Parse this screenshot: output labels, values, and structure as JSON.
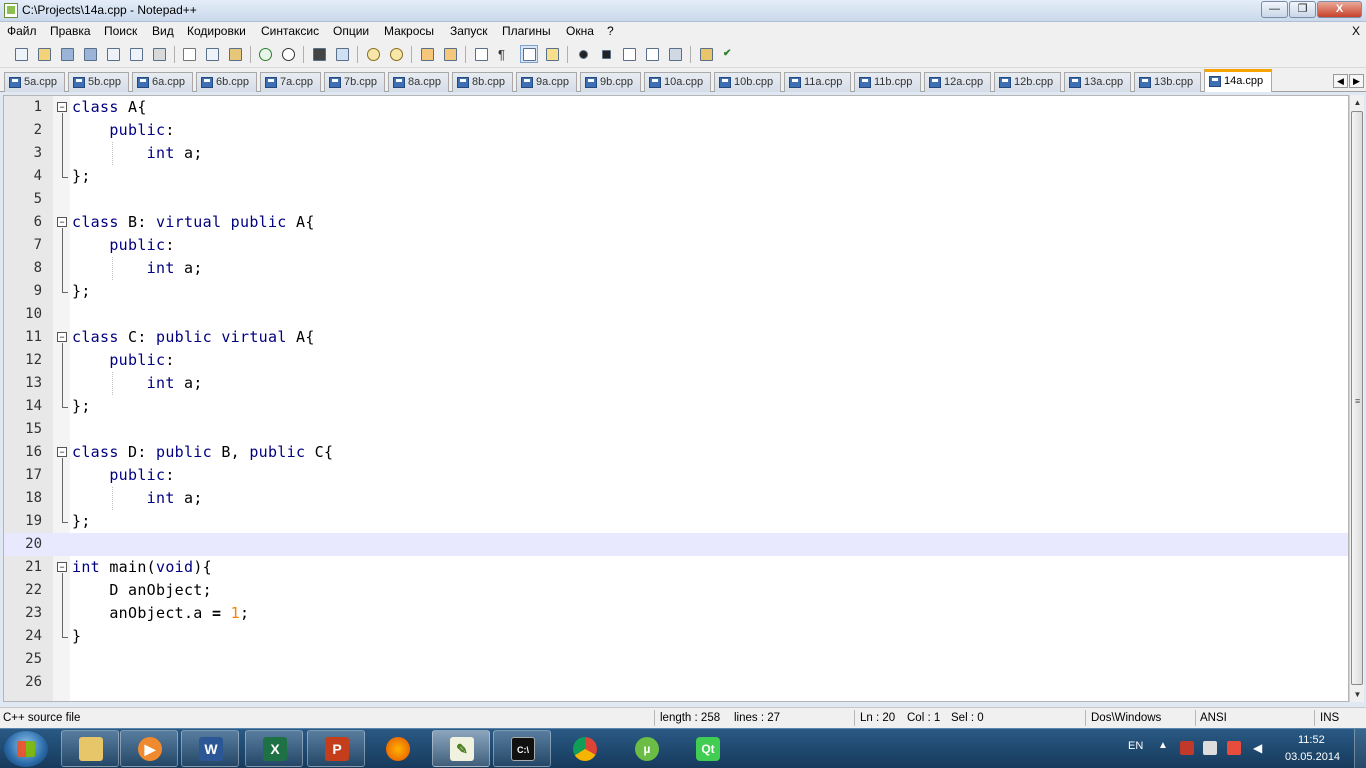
{
  "window": {
    "title": "C:\\Projects\\14a.cpp - Notepad++",
    "min": "—",
    "max": "❐",
    "close": "X"
  },
  "menu": {
    "items": [
      "Файл",
      "Правка",
      "Поиск",
      "Вид",
      "Кодировки",
      "Синтаксис",
      "Опции",
      "Макросы",
      "Запуск",
      "Плагины",
      "Окна",
      "?"
    ],
    "close": "X"
  },
  "tabs": {
    "items": [
      "5a.cpp",
      "5b.cpp",
      "6a.cpp",
      "6b.cpp",
      "7a.cpp",
      "7b.cpp",
      "8a.cpp",
      "8b.cpp",
      "9a.cpp",
      "9b.cpp",
      "10a.cpp",
      "10b.cpp",
      "11a.cpp",
      "11b.cpp",
      "12a.cpp",
      "12b.cpp",
      "13a.cpp",
      "13b.cpp",
      "14a.cpp"
    ],
    "active_index": 18,
    "nav_left": "◀",
    "nav_right": "▶"
  },
  "editor": {
    "current_line": 20,
    "line_numbers": [
      "1",
      "2",
      "3",
      "4",
      "5",
      "6",
      "7",
      "8",
      "9",
      "10",
      "11",
      "12",
      "13",
      "14",
      "15",
      "16",
      "17",
      "18",
      "19",
      "20",
      "21",
      "22",
      "23",
      "24",
      "25",
      "26"
    ],
    "lines": {
      "l1": [
        "class",
        " A{"
      ],
      "l2": [
        "public",
        ":"
      ],
      "l3": [
        "int",
        " a;"
      ],
      "l4": "};",
      "l6": [
        "class",
        " B: ",
        "virtual",
        " ",
        "public",
        " A{"
      ],
      "l7": [
        "public",
        ":"
      ],
      "l8": [
        "int",
        " a;"
      ],
      "l9": "};",
      "l11": [
        "class",
        " C: ",
        "public",
        " ",
        "virtual",
        " A{"
      ],
      "l12": [
        "public",
        ":"
      ],
      "l13": [
        "int",
        " a;"
      ],
      "l14": "};",
      "l16": [
        "class",
        " D: ",
        "public",
        " B, ",
        "public",
        " C{"
      ],
      "l17": [
        "public",
        ":"
      ],
      "l18": [
        "int",
        " a;"
      ],
      "l19": "};",
      "l21": [
        "int",
        " main(",
        "void",
        "){"
      ],
      "l22": "D anObject;",
      "l23": [
        "anObject.a ",
        "=",
        " ",
        "1",
        ";"
      ],
      "l24": "}"
    }
  },
  "status": {
    "file_type": "C++ source file",
    "length": "length : 258",
    "lines": "lines : 27",
    "ln": "Ln : 20",
    "col": "Col : 1",
    "sel": "Sel : 0",
    "eol": "Dos\\Windows",
    "encoding": "ANSI",
    "mode": "INS"
  },
  "taskbar": {
    "lang": "EN",
    "time": "11:52",
    "date": "03.05.2014",
    "apps": [
      "explorer",
      "media-player",
      "word",
      "excel",
      "powerpoint",
      "firefox",
      "notepad++",
      "cmd",
      "chrome",
      "utorrent",
      "qt-creator"
    ]
  },
  "colors": {
    "keyword": "#000080",
    "number": "#ff8000",
    "current_line": "#e8e8ff",
    "active_tab_accent": "#f8a400"
  }
}
